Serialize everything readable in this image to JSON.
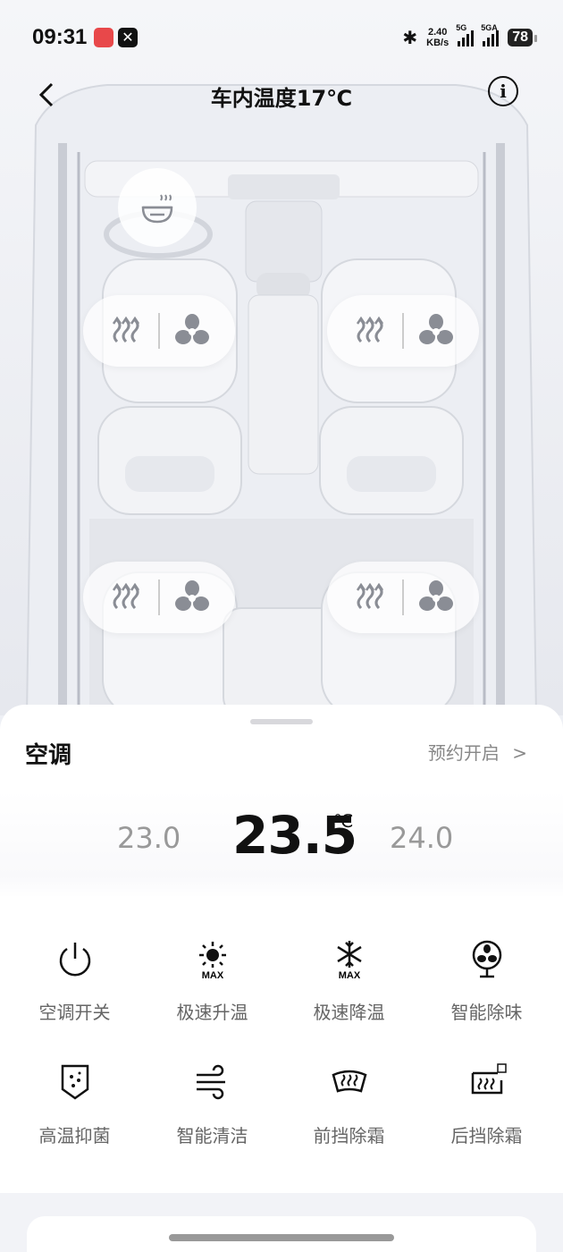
{
  "status": {
    "time": "09:31",
    "net_speed": "2.40",
    "net_unit": "KB/s",
    "sig1_label": "5G",
    "sig2_label": "5GA",
    "battery": "78"
  },
  "header": {
    "title": "车内温度17℃"
  },
  "ac": {
    "title": "空调",
    "schedule_label": "预约开启",
    "temp_lower": "23.0",
    "temp_current": "23.5",
    "temp_unit": "℃",
    "temp_higher": "24.0"
  },
  "functions": [
    {
      "label": "空调开关",
      "icon": "power-icon"
    },
    {
      "label": "极速升温",
      "icon": "sun-max-icon"
    },
    {
      "label": "极速降温",
      "icon": "snow-max-icon"
    },
    {
      "label": "智能除味",
      "icon": "deodorize-fan-icon"
    },
    {
      "label": "高温抑菌",
      "icon": "sterilize-shield-icon"
    },
    {
      "label": "智能清洁",
      "icon": "wind-clean-icon"
    },
    {
      "label": "前挡除霜",
      "icon": "front-defrost-icon"
    },
    {
      "label": "后挡除霜",
      "icon": "rear-defrost-icon"
    }
  ],
  "colors": {
    "accent": "#111111",
    "muted": "#888888"
  }
}
